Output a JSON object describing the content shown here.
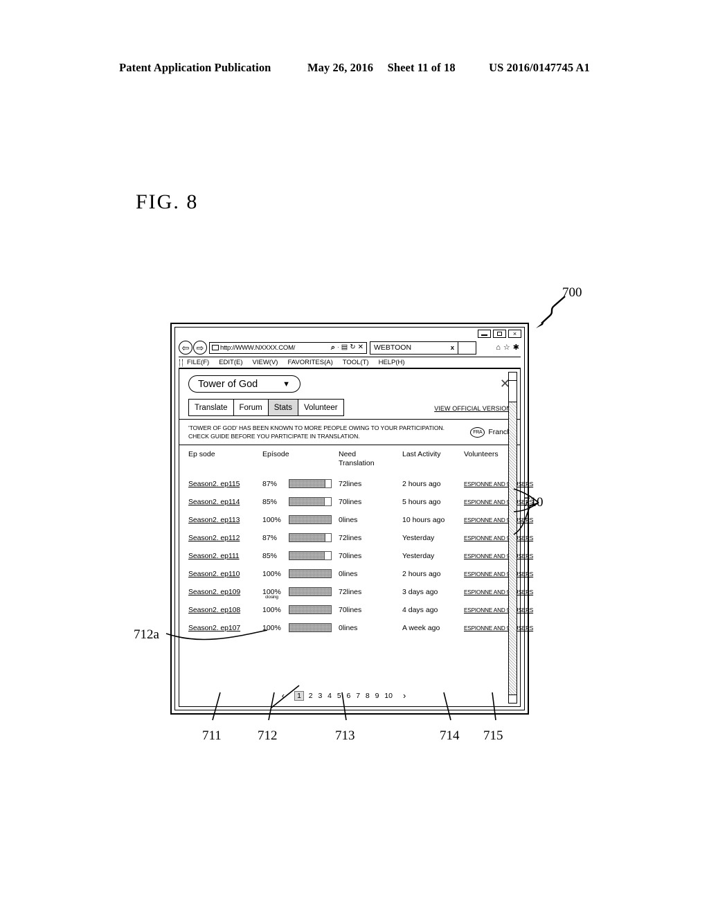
{
  "patent_header": {
    "left": "Patent Application Publication",
    "date": "May 26, 2016",
    "sheet": "Sheet 11 of 18",
    "number": "US 2016/0147745 A1"
  },
  "figure": {
    "label": "FIG.  8",
    "reference_numbers": {
      "window": "700",
      "list_region": "710",
      "episode_column": "711",
      "progress_column": "712",
      "closing_label": "712a",
      "need_translation_column": "713",
      "last_activity_column": "714",
      "volunteers_column": "715"
    }
  },
  "browser": {
    "window_controls": {
      "minimize": "minimize-icon",
      "maximize": "maximize-icon",
      "close": "×"
    },
    "nav": {
      "back": "⇦",
      "forward": "⇨"
    },
    "address": {
      "url": "http://WWW.NXXXX.COM/",
      "icons": [
        "search-icon",
        "dot-separator",
        "rss-icon",
        "refresh-icon",
        "stop-icon"
      ],
      "search_glyph": "⌕",
      "dot_glyph": "·",
      "rss_glyph": "▤",
      "refresh_glyph": "↻",
      "stop_glyph": "✕"
    },
    "tab": {
      "title": "WEBTOON",
      "close": "x"
    },
    "toolbar_right": {
      "home": "⌂",
      "favorites": "☆",
      "settings": "✱"
    },
    "menu": [
      "FILE(F)",
      "EDIT(E)",
      "VIEW(V)",
      "FAVORITES(A)",
      "TOOL(T)",
      "HELP(H)"
    ]
  },
  "page": {
    "title": "Tower of God",
    "title_caret": "▼",
    "close_glyph": "✕",
    "tabs": [
      {
        "label": "Translate",
        "active": false
      },
      {
        "label": "Forum",
        "active": false
      },
      {
        "label": "Stats",
        "active": true
      },
      {
        "label": "Volunteer",
        "active": false
      }
    ],
    "official_version_link": "VIEW OFFICIAL VERSION",
    "notice": {
      "line1": "'TOWER OF GOD' HAS BEEN KNOWN TO MORE PEOPLE OWING TO YOUR PARTICIPATION.",
      "line2": "CHECK GUIDE BEFORE YOU PARTICIPATE IN TRANSLATION."
    },
    "language": {
      "code": "FRA",
      "name": "Franch"
    },
    "table": {
      "headers": [
        "Ep sode",
        "Epísode",
        "Need Translation",
        "Last Activity",
        "Volunteers"
      ],
      "header_need_line1": "Need",
      "header_need_line2": "Translation",
      "rows": [
        {
          "episode": "Season2. ep115",
          "percent": "87%",
          "percent_value": 87,
          "sub": "",
          "need": "72lines",
          "activity": "2 hours ago",
          "volunteers": "ESPIONNE AND 99 USERS"
        },
        {
          "episode": "Season2. ep114",
          "percent": "85%",
          "percent_value": 85,
          "sub": "",
          "need": "70lines",
          "activity": "5 hours ago",
          "volunteers": "ESPIONNE AND 99 USERS"
        },
        {
          "episode": "Season2. ep113",
          "percent": "100%",
          "percent_value": 100,
          "sub": "",
          "need": "0lines",
          "activity": "10 hours ago",
          "volunteers": "ESPIONNE AND 99 USERS"
        },
        {
          "episode": "Season2. ep112",
          "percent": "87%",
          "percent_value": 87,
          "sub": "",
          "need": "72lines",
          "activity": "Yesterday",
          "volunteers": "ESPIONNE AND 99 USERS"
        },
        {
          "episode": "Season2. ep111",
          "percent": "85%",
          "percent_value": 85,
          "sub": "",
          "need": "70lines",
          "activity": "Yesterday",
          "volunteers": "ESPIONNE AND 99 USERS"
        },
        {
          "episode": "Season2. ep110",
          "percent": "100%",
          "percent_value": 100,
          "sub": "",
          "need": "0lines",
          "activity": "2 hours ago",
          "volunteers": "ESPIONNE AND 99 USERS"
        },
        {
          "episode": "Season2. ep109",
          "percent": "100%",
          "percent_value": 100,
          "sub": "closing",
          "need": "72lines",
          "activity": "3 days ago",
          "volunteers": "ESPIONNE AND 99 USERS"
        },
        {
          "episode": "Season2. ep108",
          "percent": "100%",
          "percent_value": 100,
          "sub": "",
          "need": "70lines",
          "activity": "4 days ago",
          "volunteers": "ESPIONNE AND 99 USERS"
        },
        {
          "episode": "Season2. ep107",
          "percent": "100%",
          "percent_value": 100,
          "sub": "",
          "need": "0lines",
          "activity": "A week ago",
          "volunteers": "ESPIONNE AND 99 USERS"
        }
      ]
    },
    "pagination": {
      "prev": "‹",
      "next": "›",
      "pages": [
        "1",
        "2",
        "3",
        "4",
        "5",
        "6",
        "7",
        "8",
        "9",
        "10"
      ],
      "current": "1"
    }
  }
}
